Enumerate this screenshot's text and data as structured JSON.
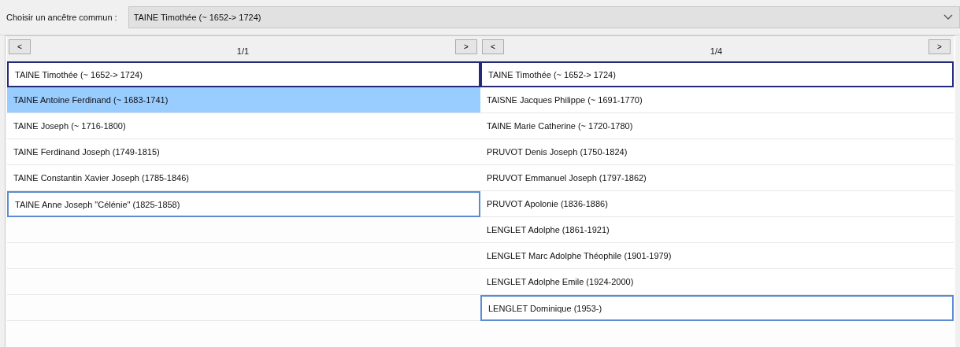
{
  "ancestor_picker": {
    "label": "Choisir un ancêtre commun :",
    "value": "TAINE Timothée (~ 1652-> 1724)"
  },
  "columns": [
    {
      "prev": "<",
      "page": "1/1",
      "next": ">",
      "rows": [
        {
          "text": "TAINE Timothée (~ 1652-> 1724)",
          "kind": "root",
          "selected": false
        },
        {
          "text": "TAINE Antoine Ferdinand (~ 1683-1741)",
          "kind": "plain",
          "selected": true
        },
        {
          "text": "TAINE Joseph (~ 1716-1800)",
          "kind": "plain",
          "selected": false
        },
        {
          "text": "TAINE Ferdinand Joseph (1749-1815)",
          "kind": "plain",
          "selected": false
        },
        {
          "text": "TAINE Constantin Xavier Joseph (1785-1846)",
          "kind": "plain",
          "selected": false
        },
        {
          "text": "TAINE Anne Joseph \"Célénie\" (1825-1858)",
          "kind": "end",
          "selected": false
        }
      ]
    },
    {
      "prev": "<",
      "page": "1/4",
      "next": ">",
      "rows": [
        {
          "text": "TAINE Timothée (~ 1652-> 1724)",
          "kind": "root",
          "selected": false
        },
        {
          "text": "TAISNE Jacques Philippe (~ 1691-1770)",
          "kind": "plain",
          "selected": false
        },
        {
          "text": "TAINE Marie Catherine (~ 1720-1780)",
          "kind": "plain",
          "selected": false
        },
        {
          "text": "PRUVOT Denis Joseph (1750-1824)",
          "kind": "plain",
          "selected": false
        },
        {
          "text": "PRUVOT Emmanuel Joseph (1797-1862)",
          "kind": "plain",
          "selected": false
        },
        {
          "text": "PRUVOT Apolonie (1836-1886)",
          "kind": "plain",
          "selected": false
        },
        {
          "text": "LENGLET Adolphe (1861-1921)",
          "kind": "plain",
          "selected": false
        },
        {
          "text": "LENGLET Marc Adolphe Théophile (1901-1979)",
          "kind": "plain",
          "selected": false
        },
        {
          "text": "LENGLET Adolphe Emile (1924-2000)",
          "kind": "plain",
          "selected": false
        },
        {
          "text": "LENGLET Dominique (1953-)",
          "kind": "end",
          "selected": false
        }
      ]
    }
  ]
}
